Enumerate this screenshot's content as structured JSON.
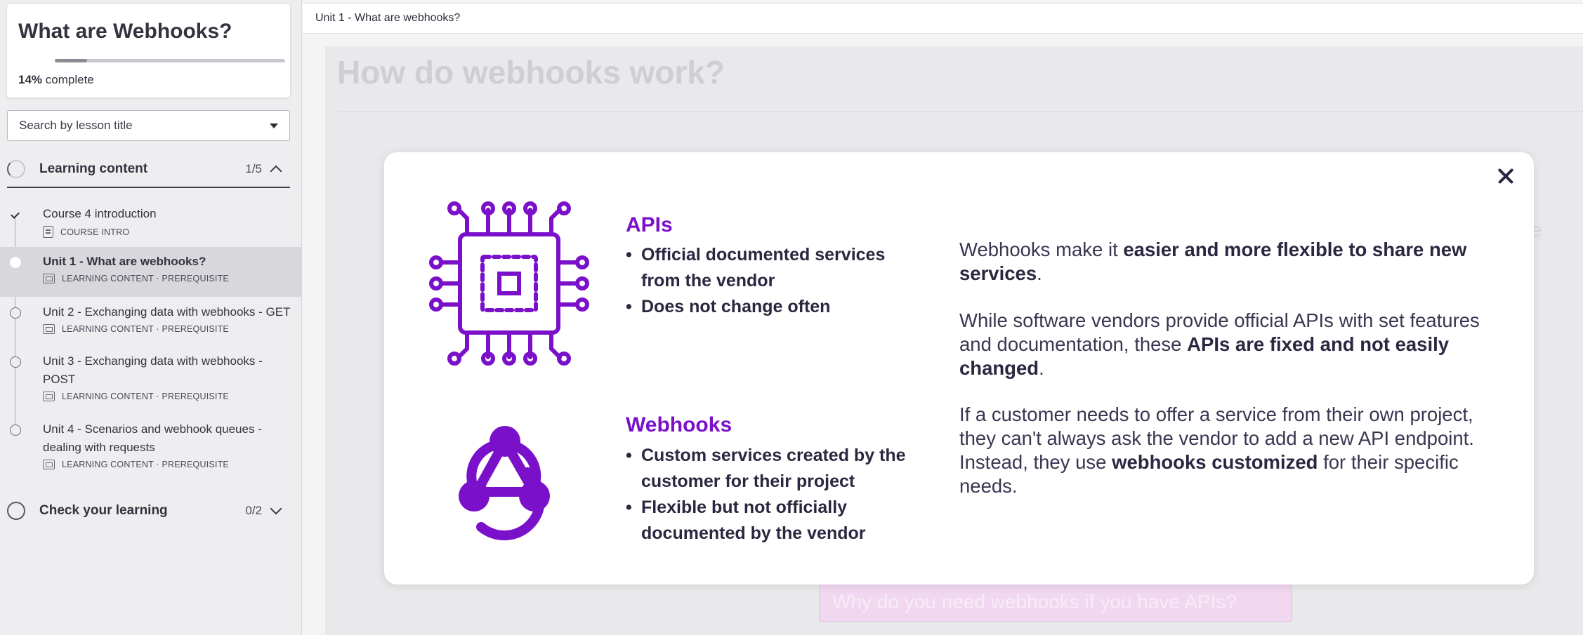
{
  "sidebar": {
    "course_title": "What are Webhooks?",
    "progress_percent": 14,
    "progress_value_label": "14%",
    "progress_suffix": "complete",
    "search_placeholder": "Search by lesson title",
    "sections": [
      {
        "label": "Learning content",
        "count": "1/5",
        "expanded": true
      },
      {
        "label": "Check your learning",
        "count": "0/2",
        "expanded": false
      }
    ],
    "lessons": [
      {
        "title": "Course 4 introduction",
        "meta": "COURSE INTRO",
        "status": "completed",
        "icon": "document-icon"
      },
      {
        "title": "Unit 1 - What are webhooks?",
        "meta": "LEARNING CONTENT · PREREQUISITE",
        "status": "current",
        "icon": "slides-icon"
      },
      {
        "title": "Unit 2 - Exchanging data with webhooks - GET",
        "meta": "LEARNING CONTENT · PREREQUISITE",
        "status": "not-started",
        "icon": "slides-icon"
      },
      {
        "title": "Unit 3 - Exchanging data with webhooks - POST",
        "meta": "LEARNING CONTENT · PREREQUISITE",
        "status": "not-started",
        "icon": "slides-icon"
      },
      {
        "title": "Unit 4 - Scenarios and webhook queues - dealing with requests",
        "meta": "LEARNING CONTENT · PREREQUISITE",
        "status": "not-started",
        "icon": "slides-icon"
      }
    ]
  },
  "topbar": {
    "breadcrumb": "Unit 1 - What are webhooks?"
  },
  "background": {
    "page_title": "How do webhooks work?",
    "question_button": "Why do you need webhooks if you have APIs?",
    "partial_letter": "e"
  },
  "modal": {
    "apis": {
      "title": "APIs",
      "icon": "circuit-chip-icon",
      "bullets": [
        "Official documented services from the vendor",
        "Does not change often"
      ]
    },
    "webhooks": {
      "title": "Webhooks",
      "icon": "webhook-icon",
      "bullets": [
        "Custom services created by the customer for their project",
        "Flexible but not officially documented by the vendor"
      ]
    },
    "paragraphs": [
      {
        "pre": "Webhooks make it ",
        "bold": "easier and more flexible to share new services",
        "post": "."
      },
      {
        "pre": "While software vendors provide official APIs with set features and documentation, these ",
        "bold": "APIs are fixed and not easily changed",
        "post": "."
      },
      {
        "pre": "If a customer needs to offer a service from their own project, they can't always ask the vendor to add a new API endpoint. Instead, they use ",
        "bold": "webhooks customized",
        "post": " for their specific needs."
      }
    ]
  },
  "colors": {
    "accent_purple": "#7a10c9",
    "text_dark": "#2b2740"
  }
}
